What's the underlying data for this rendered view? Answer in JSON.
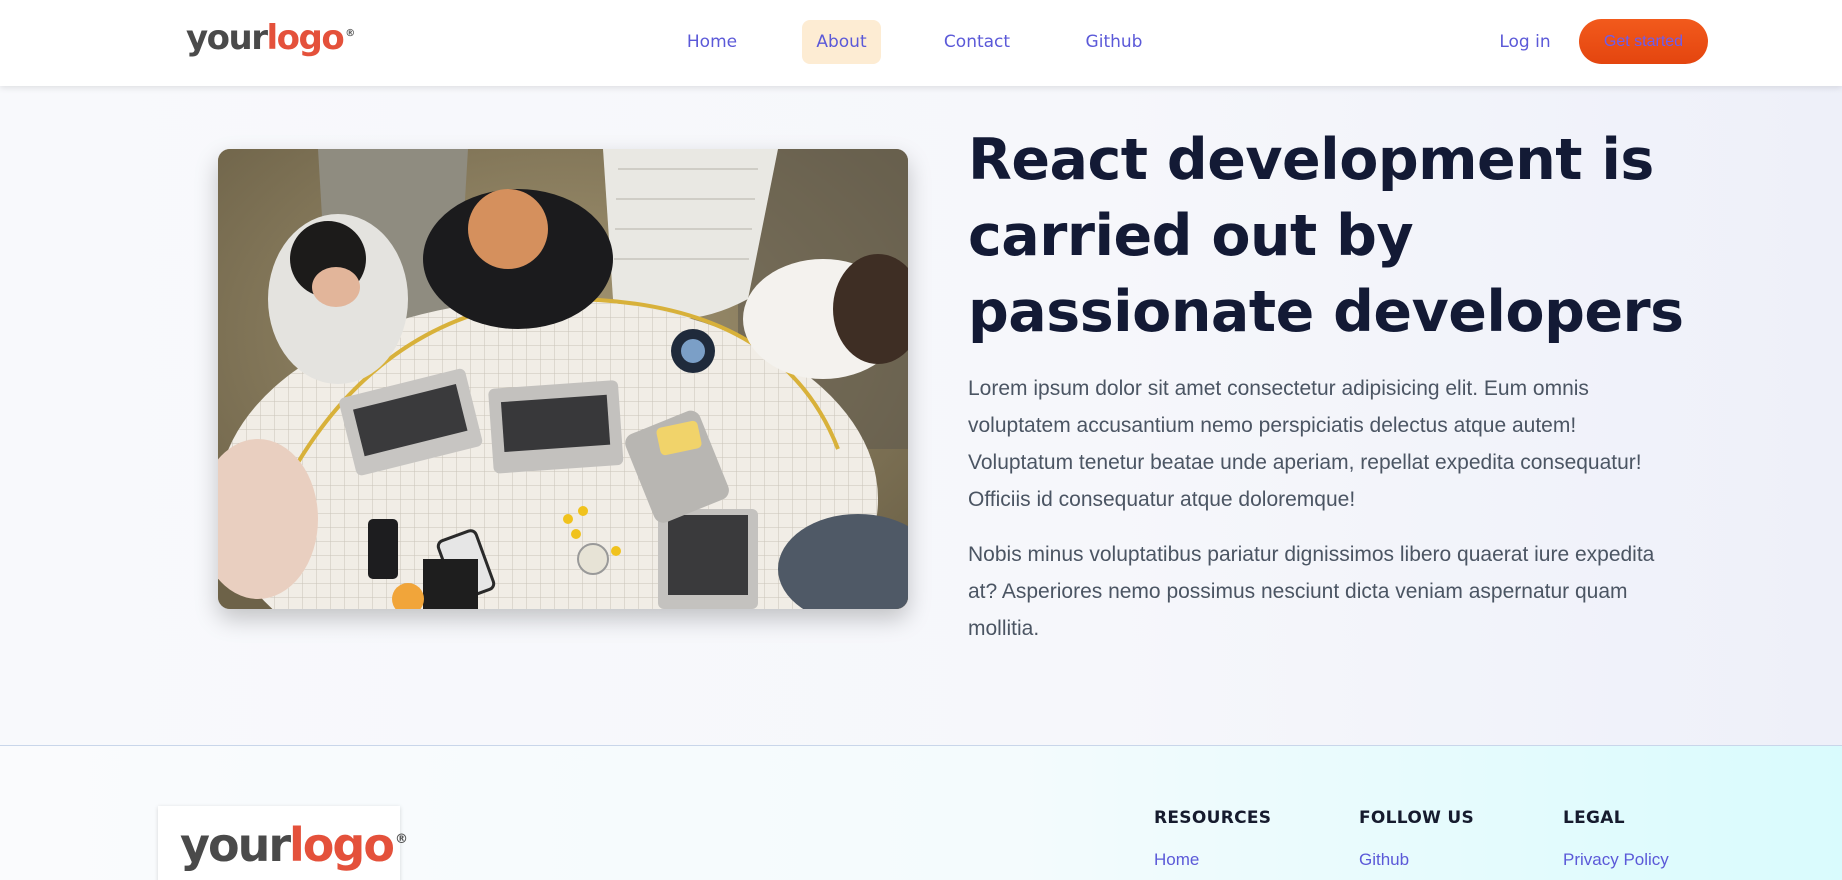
{
  "header": {
    "logo": {
      "word1": "your",
      "word2": "logo",
      "mark": "®"
    },
    "nav": [
      {
        "label": "Home"
      },
      {
        "label": "About",
        "active": true
      },
      {
        "label": "Contact"
      },
      {
        "label": "Github"
      }
    ],
    "login_label": "Log in",
    "cta_label": "Get started"
  },
  "main": {
    "headline": "React development is carried out by passionate developers",
    "paragraphs": [
      "Lorem ipsum dolor sit amet consectetur adipisicing elit. Eum omnis voluptatem accusantium nemo perspiciatis delectus atque autem! Voluptatum tenetur beatae unde aperiam, repellat expedita consequatur! Officiis id consequatur atque doloremque!",
      "Nobis minus voluptatibus pariatur dignissimos libero quaerat iure expedita at? Asperiores nemo possimus nesciunt dicta veniam aspernatur quam mollitia."
    ]
  },
  "footer": {
    "logo": {
      "word1": "your",
      "word2": "logo",
      "mark": "®"
    },
    "columns": [
      {
        "title": "RESOURCES",
        "links": [
          "Home"
        ]
      },
      {
        "title": "FOLLOW US",
        "links": [
          "Github"
        ]
      },
      {
        "title": "LEGAL",
        "links": [
          "Privacy Policy"
        ]
      }
    ]
  },
  "colors": {
    "accent": "#5b59d8",
    "brand_red": "#e4513b",
    "cta_orange": "#f25a1c",
    "active_nav_bg": "#fdecd3",
    "headline": "#131a35"
  }
}
